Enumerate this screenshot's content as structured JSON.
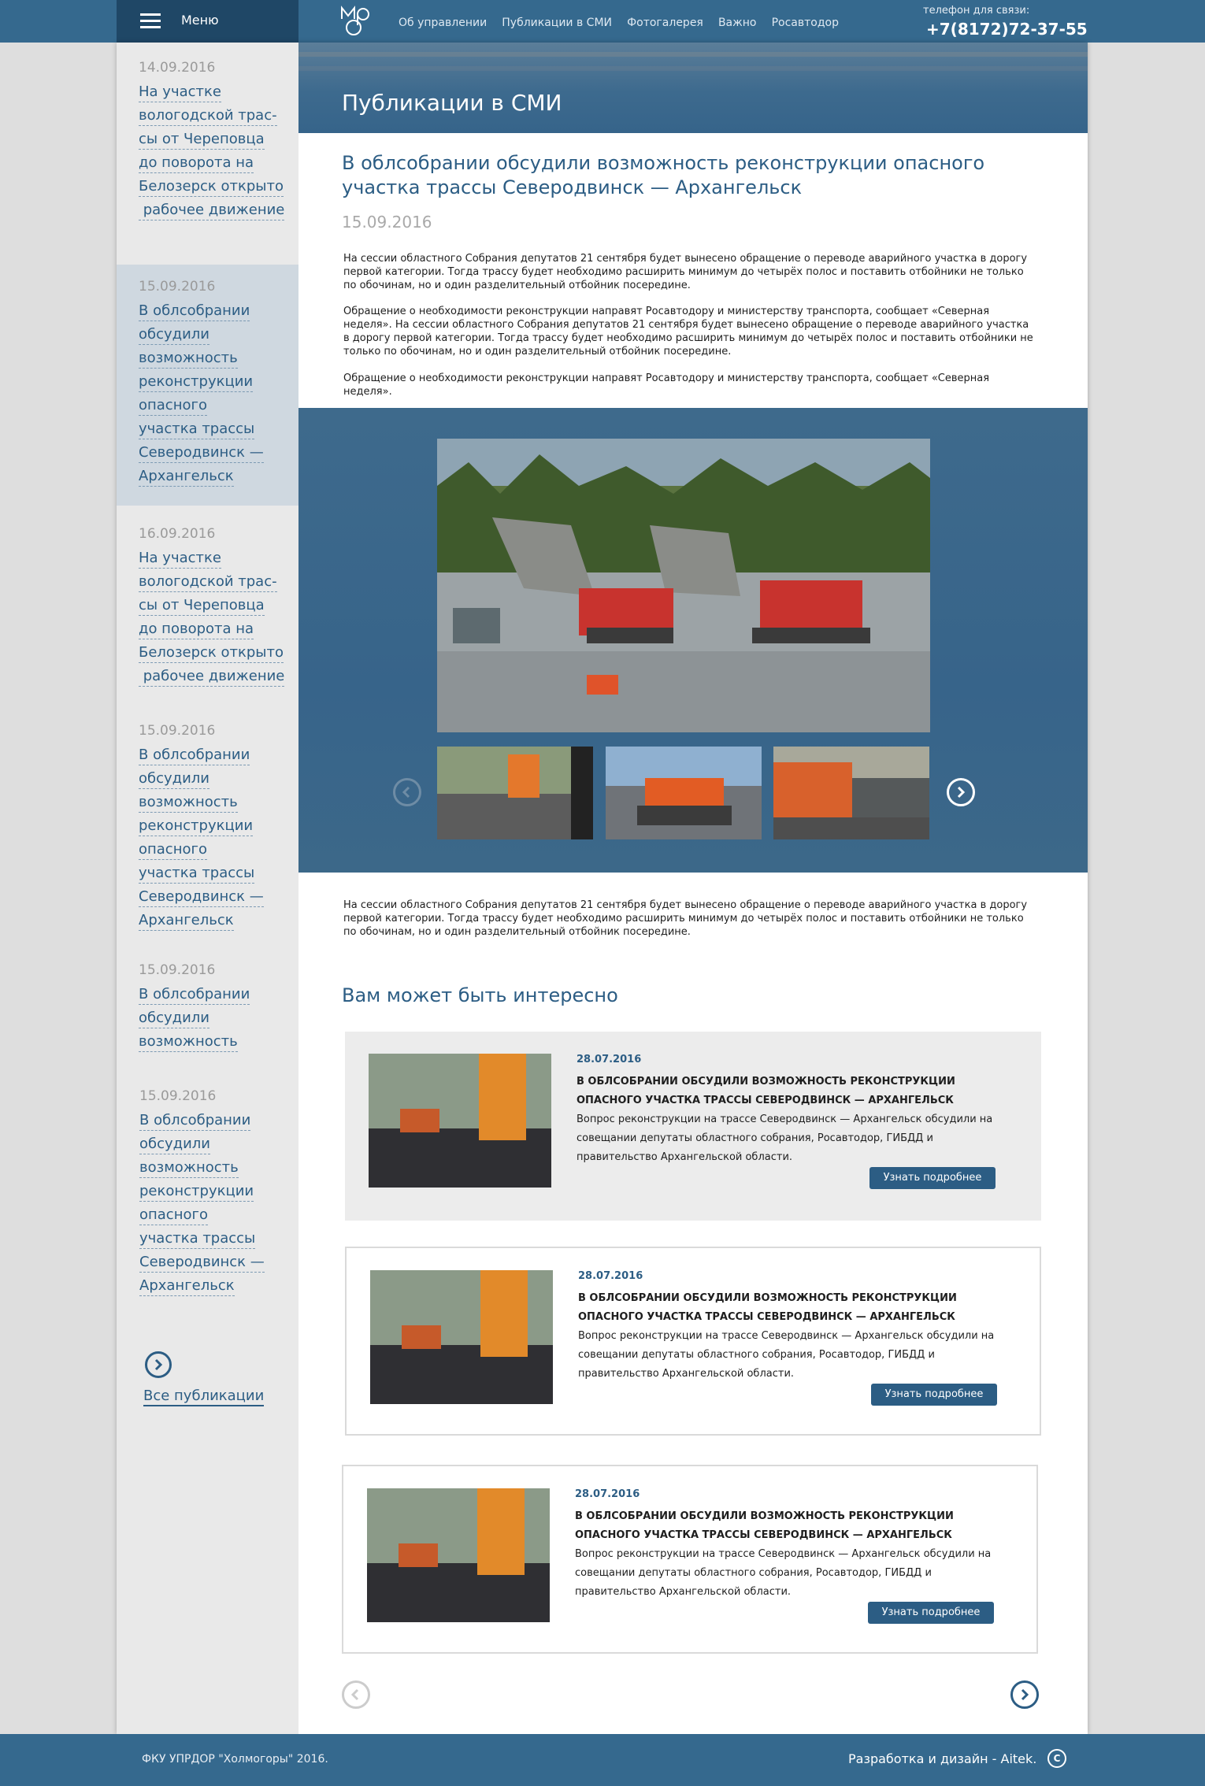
{
  "header": {
    "menu_label": "Меню",
    "nav": [
      "Об управлении",
      "Публикации в СМИ",
      "Фотогалерея",
      "Важно",
      "Росавтодор"
    ],
    "phone_caption": "телефон для связи:",
    "phone": "+7(8172)72-37-55"
  },
  "sidebar": {
    "items": [
      {
        "date": "14.09.2016",
        "lines": [
          "На участке",
          "вологодской трас-",
          "сы от Череповца",
          "до поворота на",
          "Белозерск открыто",
          " рабочее движение"
        ]
      },
      {
        "date": "15.09.2016",
        "lines": [
          "В облсобрании",
          "обсудили",
          "возможность",
          "реконструкции",
          "опасного",
          "участка трассы",
          "Северодвинск —",
          "Архангельск"
        ]
      },
      {
        "date": "16.09.2016",
        "lines": [
          "На участке",
          "вологодской трас-",
          "сы от Череповца",
          "до поворота на",
          "Белозерск открыто",
          " рабочее движение"
        ]
      },
      {
        "date": "15.09.2016",
        "lines": [
          "В облсобрании",
          "обсудили",
          "возможность",
          "реконструкции",
          "опасного",
          "участка трассы",
          "Северодвинск —",
          "Архангельск"
        ]
      },
      {
        "date": "15.09.2016",
        "lines": [
          "В облсобрании",
          "обсудили",
          "возможность"
        ]
      },
      {
        "date": "15.09.2016",
        "lines": [
          "В облсобрании",
          "обсудили",
          "возможность",
          "реконструкции",
          "опасного",
          "участка трассы",
          "Северодвинск —",
          "Архангельск"
        ]
      }
    ],
    "all_label": "Все публикации"
  },
  "page": {
    "section_title": "Публикации в СМИ",
    "article_title": "В облсобрании обсудили возможность реконструкции опасного участка трассы Северодвинск — Архангельск",
    "article_date": "15.09.2016",
    "paragraphs": [
      "На сессии областного Собрания депутатов 21 сентября будет вынесено обращение о переводе аварийного участка в дорогу первой категории. Тогда трассу будет необходимо расширить минимум до четырёх полос и поставить отбойники не только по обочинам, но и один разделительный отбойник посередине.",
      "Обращение о необходимости реконструкции направят Росавтодору и министерству транспорта, сообщает «Северная неделя». На сессии областного Собрания депутатов 21 сентября будет вынесено обращение о переводе аварийного участка в дорогу первой категории. Тогда трассу будет необходимо расширить минимум до четырёх полос и поставить отбойники не только по обочинам, но и один разделительный отбойник посередине.",
      "Обращение о необходимости реконструкции направят Росавтодору и министерству транспорта, сообщает «Северная неделя».",
      "На сессии областного Собрания депутатов 21 сентября будет вынесено обращение о переводе аварийного участка в дорогу первой категории. Тогда трассу будет необходимо расширить минимум до четырёх полос и поставить отбойники не только по обочинам, но и один разделительный отбойник посередине."
    ],
    "related_heading": "Вам может быть интересно",
    "related": [
      {
        "date": "28.07.2016",
        "title": "В облсобрании обсудили возможность реконструкции опасного участка трассы Северодвинск — Архангельск",
        "text": "Вопрос реконструкции на трассе Северодвинск — Архангельск обсудили на совещании депутаты областного собрания, Росавтодор, ГИБДД и правительство Архангельской области.",
        "button": "Узнать подробнее"
      },
      {
        "date": "28.07.2016",
        "title": "В облсобрании обсудили возможность реконструкции опасного участка трассы Северодвинск — Архангельск",
        "text": "Вопрос реконструкции на трассе Северодвинск — Архангельск обсудили на совещании депутаты областного собрания, Росавтодор, ГИБДД и правительство Архангельской области.",
        "button": "Узнать подробнее"
      },
      {
        "date": "28.07.2016",
        "title": "В облсобрании обсудили возможность реконструкции опасного участка трассы Северодвинск — Архангельск",
        "text": "Вопрос реконструкции на трассе Северодвинск — Архангельск обсудили на совещании депутаты областного собрания, Росавтодор, ГИБДД и правительство Архангельской области.",
        "button": "Узнать подробнее"
      }
    ]
  },
  "footer": {
    "left": "ФКУ УПРДОР \"Холмогоры\" 2016.",
    "right": "Разработка и дизайн - Aitek.",
    "copy_symbol": "C"
  },
  "colors": {
    "accent": "#2c5d84",
    "header": "#35698e",
    "menu": "#1f4766"
  }
}
